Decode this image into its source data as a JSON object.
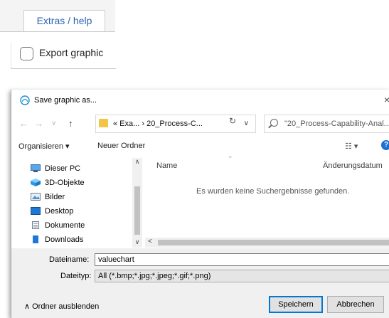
{
  "tab": {
    "label": "Extras / help"
  },
  "export": {
    "label": "Export graphic",
    "checked": false
  },
  "dialog": {
    "title": "Save graphic as...",
    "close": "×",
    "nav": {
      "back": "←",
      "forward": "→",
      "recent": "∨",
      "up": "↑",
      "address": "« Exa...  ›  20_Process-C...",
      "refresh": "↻",
      "search_placeholder": "\"20_Process-Capability-Anal..."
    },
    "toolbar": {
      "organize": "Organisieren ▾",
      "new_folder": "Neuer Ordner",
      "view": "☷ ▾",
      "help": "?"
    },
    "tree": [
      {
        "label": "Dieser PC",
        "icon": "computer-icon"
      },
      {
        "label": "3D-Objekte",
        "icon": "3d-objects-icon"
      },
      {
        "label": "Bilder",
        "icon": "pictures-icon"
      },
      {
        "label": "Desktop",
        "icon": "desktop-icon"
      },
      {
        "label": "Dokumente",
        "icon": "documents-icon"
      },
      {
        "label": "Downloads",
        "icon": "downloads-icon"
      }
    ],
    "columns": {
      "name": "Name",
      "date": "Änderungsdatum"
    },
    "empty_message": "Es wurden keine Suchergebnisse gefunden.",
    "filename_label": "Dateiname:",
    "filename_value": "valuechart",
    "filetype_label": "Dateityp:",
    "filetype_value": "All (*.bmp;*.jpg;*.jpeg;*.gif;*.png)",
    "collapse_label": "∧  Ordner ausblenden",
    "save_button": "Speichern",
    "cancel_button": "Abbrechen"
  },
  "colors": {
    "tab_text": "#2b63b2",
    "accent": "#0078d7",
    "folder": "#f4c542"
  }
}
